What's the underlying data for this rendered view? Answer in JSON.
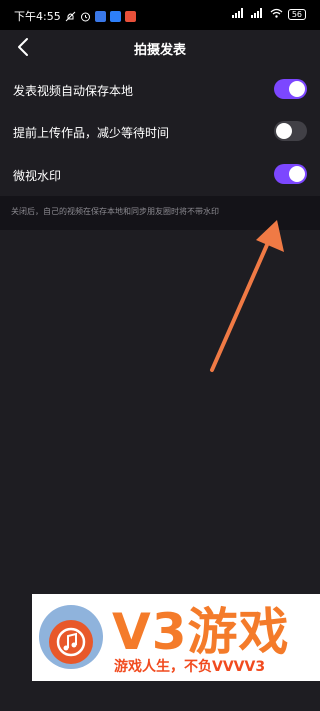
{
  "status_bar": {
    "time": "下午4:55",
    "battery": "56"
  },
  "header": {
    "title": "拍摄发表"
  },
  "settings": {
    "items": [
      {
        "label": "发表视频自动保存本地",
        "enabled": true
      },
      {
        "label": "提前上传作品，减少等待时间",
        "enabled": false
      },
      {
        "label": "微视水印",
        "enabled": true
      }
    ],
    "hint": "关闭后，自己的视频在保存本地和同步朋友圈时将不带水印"
  },
  "banner": {
    "brand": "V3游戏",
    "tagline": "游戏人生，不负VVVV3"
  },
  "colors": {
    "toggle_on": "#7c47ff",
    "toggle_off": "#414046",
    "background": "#1e1d22",
    "arrow": "#f07a45"
  },
  "icons": [
    "back-arrow-icon",
    "mute-icon",
    "alarm-icon",
    "wifi-icon",
    "signal-icon",
    "battery-icon"
  ]
}
